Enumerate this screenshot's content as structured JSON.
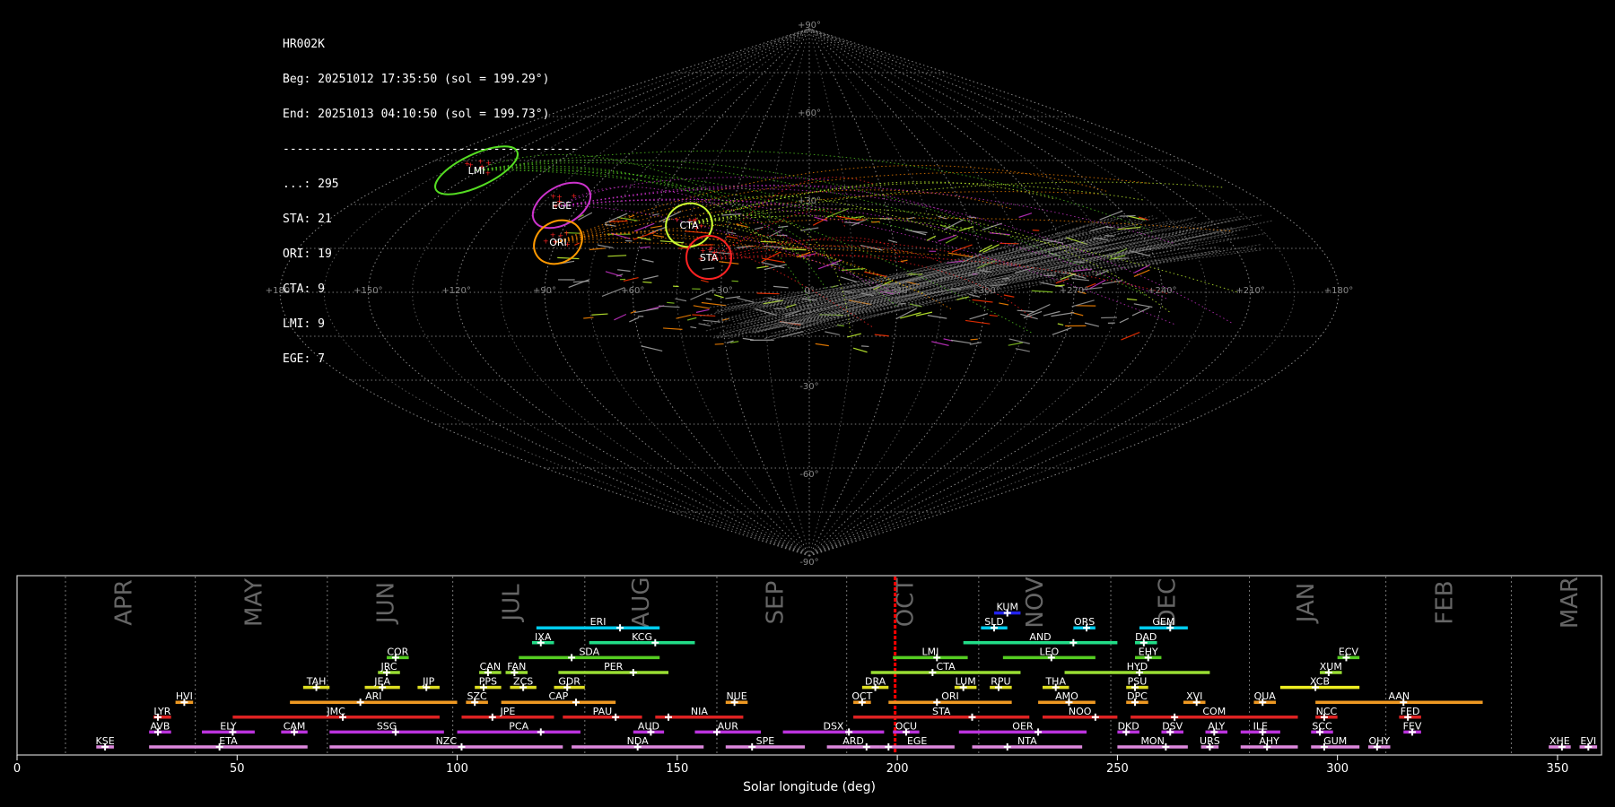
{
  "info": {
    "station": "HR002K",
    "beg": "Beg: 20251012 17:35:50 (sol = 199.29°)",
    "end": "End: 20251013 04:10:50 (sol = 199.73°)",
    "separator": "------------------------------------------",
    "counts": [
      "...: 295",
      "STA: 21",
      "ORI: 19",
      "CTA: 9",
      "LMI: 9",
      "EGE: 7"
    ]
  },
  "sky_map": {
    "projection": "sinusoidal",
    "lon_labels": [
      "+180°",
      "+150°",
      "+120°",
      "+90°",
      "+60°",
      "+30°",
      "0°",
      "+330°",
      "+300°",
      "+270°",
      "+240°",
      "+210°",
      "+180°"
    ],
    "lat_labels": [
      "+90°",
      "+60°",
      "+30°",
      "0°",
      "-30°",
      "-60°",
      "-90°"
    ],
    "radiants": [
      {
        "code": "LMI",
        "color": "#7CFC00",
        "ring": "#55dd22"
      },
      {
        "code": "EGE",
        "color": "#cc33cc",
        "ring": "#cc33cc"
      },
      {
        "code": "ORI",
        "color": "#ff9900",
        "ring": "#ff9900"
      },
      {
        "code": "CTA",
        "color": "#ccff33",
        "ring": "#ccff33"
      },
      {
        "code": "STA",
        "color": "#ff2222",
        "ring": "#ff2222"
      }
    ]
  },
  "chart_data": {
    "type": "bar",
    "title": "",
    "xlabel": "Solar longitude (deg)",
    "ylabel": "",
    "xlim": [
      0,
      360
    ],
    "xticks": [
      0,
      50,
      100,
      150,
      200,
      250,
      300,
      350
    ],
    "current_sol": 199.5,
    "months": [
      {
        "name": "APR",
        "start": 11,
        "label_x": 24.5
      },
      {
        "name": "MAY",
        "start": 40.5,
        "label_x": 54
      },
      {
        "name": "JUN",
        "start": 70.5,
        "label_x": 84
      },
      {
        "name": "JUL",
        "start": 99,
        "label_x": 112.5
      },
      {
        "name": "AUG",
        "start": 129,
        "label_x": 142
      },
      {
        "name": "SEP",
        "start": 159,
        "label_x": 172.5
      },
      {
        "name": "OCT",
        "start": 188.5,
        "label_x": 202
      },
      {
        "name": "NOV",
        "start": 218.5,
        "label_x": 231.5
      },
      {
        "name": "DEC",
        "start": 248.5,
        "label_x": 261.5
      },
      {
        "name": "JAN",
        "start": 280,
        "label_x": 293
      },
      {
        "name": "FEB",
        "start": 311,
        "label_x": 324.5
      },
      {
        "name": "MAR",
        "start": 339.5,
        "label_x": 353
      }
    ],
    "showers": [
      {
        "code": "KUM",
        "start": 222,
        "end": 228,
        "peak": 225,
        "row": 10,
        "color": "#2222ee"
      },
      {
        "code": "ERI",
        "start": 118,
        "end": 146,
        "peak": 137,
        "row": 9,
        "color": "#00ccee"
      },
      {
        "code": "SLD",
        "start": 219,
        "end": 225,
        "peak": 222,
        "row": 9,
        "color": "#00ccee"
      },
      {
        "code": "ORS",
        "start": 240,
        "end": 245,
        "peak": 243,
        "row": 9,
        "color": "#00ccee"
      },
      {
        "code": "GEM",
        "start": 255,
        "end": 266,
        "peak": 262,
        "row": 9,
        "color": "#00ccee"
      },
      {
        "code": "IXA",
        "start": 117,
        "end": 122,
        "peak": 119,
        "row": 8,
        "color": "#22dd88"
      },
      {
        "code": "KCG",
        "start": 130,
        "end": 154,
        "peak": 145,
        "row": 8,
        "color": "#22dd88"
      },
      {
        "code": "AND",
        "start": 215,
        "end": 250,
        "peak": 240,
        "row": 8,
        "color": "#22dd88"
      },
      {
        "code": "DAD",
        "start": 254,
        "end": 259,
        "peak": 256,
        "row": 8,
        "color": "#22dd88"
      },
      {
        "code": "COR",
        "start": 84,
        "end": 89,
        "peak": 86,
        "row": 7,
        "color": "#55cc22"
      },
      {
        "code": "SDA",
        "start": 114,
        "end": 146,
        "peak": 126,
        "row": 7,
        "color": "#55cc22"
      },
      {
        "code": "LMI",
        "start": 199,
        "end": 216,
        "peak": 209,
        "row": 7,
        "color": "#55cc22"
      },
      {
        "code": "LEO",
        "start": 224,
        "end": 245,
        "peak": 235,
        "row": 7,
        "color": "#55cc22"
      },
      {
        "code": "EHY",
        "start": 254,
        "end": 260,
        "peak": 257,
        "row": 7,
        "color": "#55cc22"
      },
      {
        "code": "ECV",
        "start": 300,
        "end": 305,
        "peak": 302,
        "row": 7,
        "color": "#55cc22"
      },
      {
        "code": "JRC",
        "start": 82,
        "end": 87,
        "peak": 84,
        "row": 6,
        "color": "#99dd33"
      },
      {
        "code": "CAN",
        "start": 105,
        "end": 110,
        "peak": 107,
        "row": 6,
        "color": "#99dd33"
      },
      {
        "code": "FAN",
        "start": 111,
        "end": 116,
        "peak": 113,
        "row": 6,
        "color": "#99dd33"
      },
      {
        "code": "PER",
        "start": 123,
        "end": 148,
        "peak": 140,
        "row": 6,
        "color": "#99dd33"
      },
      {
        "code": "CTA",
        "start": 194,
        "end": 228,
        "peak": 208,
        "row": 6,
        "color": "#99dd33"
      },
      {
        "code": "HYD",
        "start": 238,
        "end": 271,
        "peak": 255,
        "row": 6,
        "color": "#99dd33"
      },
      {
        "code": "XUM",
        "start": 296,
        "end": 301,
        "peak": 298,
        "row": 6,
        "color": "#99dd33"
      },
      {
        "code": "TAH",
        "start": 65,
        "end": 71,
        "peak": 68,
        "row": 5,
        "color": "#dddd22"
      },
      {
        "code": "JEA",
        "start": 79,
        "end": 87,
        "peak": 83,
        "row": 5,
        "color": "#dddd22"
      },
      {
        "code": "JIP",
        "start": 91,
        "end": 96,
        "peak": 93,
        "row": 5,
        "color": "#dddd22"
      },
      {
        "code": "PPS",
        "start": 104,
        "end": 110,
        "peak": 106,
        "row": 5,
        "color": "#dddd22"
      },
      {
        "code": "ZCS",
        "start": 112,
        "end": 118,
        "peak": 115,
        "row": 5,
        "color": "#dddd22"
      },
      {
        "code": "GDR",
        "start": 122,
        "end": 129,
        "peak": 125,
        "row": 5,
        "color": "#dddd22"
      },
      {
        "code": "DRA",
        "start": 192,
        "end": 198,
        "peak": 195,
        "row": 5,
        "color": "#dddd22"
      },
      {
        "code": "LUM",
        "start": 213,
        "end": 218,
        "peak": 215,
        "row": 5,
        "color": "#dddd22"
      },
      {
        "code": "RPU",
        "start": 221,
        "end": 226,
        "peak": 223,
        "row": 5,
        "color": "#dddd22"
      },
      {
        "code": "THA",
        "start": 233,
        "end": 239,
        "peak": 236,
        "row": 5,
        "color": "#dddd22"
      },
      {
        "code": "PSU",
        "start": 252,
        "end": 257,
        "peak": 254,
        "row": 5,
        "color": "#dddd22"
      },
      {
        "code": "XCB",
        "start": 287,
        "end": 305,
        "peak": 295,
        "row": 5,
        "color": "#eeee22"
      },
      {
        "code": "HVI",
        "start": 36,
        "end": 40,
        "peak": 38,
        "row": 4,
        "color": "#ee9922"
      },
      {
        "code": "ARI",
        "start": 62,
        "end": 100,
        "peak": 78,
        "row": 4,
        "color": "#ee9922"
      },
      {
        "code": "SZC",
        "start": 102,
        "end": 107,
        "peak": 104,
        "row": 4,
        "color": "#ee9922"
      },
      {
        "code": "CAP",
        "start": 110,
        "end": 136,
        "peak": 127,
        "row": 4,
        "color": "#ee9922"
      },
      {
        "code": "NUE",
        "start": 161,
        "end": 166,
        "peak": 163,
        "row": 4,
        "color": "#ee9922"
      },
      {
        "code": "OCT",
        "start": 190,
        "end": 194,
        "peak": 192,
        "row": 4,
        "color": "#ee9922"
      },
      {
        "code": "ORI",
        "start": 198,
        "end": 226,
        "peak": 209,
        "row": 4,
        "color": "#ee9922"
      },
      {
        "code": "AMO",
        "start": 232,
        "end": 245,
        "peak": 239,
        "row": 4,
        "color": "#ee9922"
      },
      {
        "code": "DPC",
        "start": 252,
        "end": 257,
        "peak": 254,
        "row": 4,
        "color": "#ee9922"
      },
      {
        "code": "XVI",
        "start": 265,
        "end": 270,
        "peak": 268,
        "row": 4,
        "color": "#ee9922"
      },
      {
        "code": "QUA",
        "start": 281,
        "end": 286,
        "peak": 283,
        "row": 4,
        "color": "#ee9922"
      },
      {
        "code": "AAN",
        "start": 295,
        "end": 333,
        "peak": 315,
        "row": 4,
        "color": "#ee9922"
      },
      {
        "code": "LYR",
        "start": 31,
        "end": 35,
        "peak": 32,
        "row": 3,
        "color": "#dd2222"
      },
      {
        "code": "JMC",
        "start": 49,
        "end": 96,
        "peak": 74,
        "row": 3,
        "color": "#dd2222"
      },
      {
        "code": "JPE",
        "start": 101,
        "end": 122,
        "peak": 108,
        "row": 3,
        "color": "#dd2222"
      },
      {
        "code": "PAU",
        "start": 124,
        "end": 142,
        "peak": 136,
        "row": 3,
        "color": "#dd2222"
      },
      {
        "code": "NIA",
        "start": 145,
        "end": 165,
        "peak": 148,
        "row": 3,
        "color": "#dd2222"
      },
      {
        "code": "STA",
        "start": 190,
        "end": 230,
        "peak": 217,
        "row": 3,
        "color": "#dd2222"
      },
      {
        "code": "NOO",
        "start": 233,
        "end": 250,
        "peak": 245,
        "row": 3,
        "color": "#dd2222"
      },
      {
        "code": "COM",
        "start": 253,
        "end": 291,
        "peak": 263,
        "row": 3,
        "color": "#dd2222"
      },
      {
        "code": "NCC",
        "start": 295,
        "end": 300,
        "peak": 297,
        "row": 3,
        "color": "#dd2222"
      },
      {
        "code": "FED",
        "start": 314,
        "end": 319,
        "peak": 316,
        "row": 3,
        "color": "#dd2222"
      },
      {
        "code": "AVB",
        "start": 30,
        "end": 35,
        "peak": 32,
        "row": 2,
        "color": "#bb33dd"
      },
      {
        "code": "ELY",
        "start": 42,
        "end": 54,
        "peak": 49,
        "row": 2,
        "color": "#bb33dd"
      },
      {
        "code": "CAM",
        "start": 60,
        "end": 66,
        "peak": 63,
        "row": 2,
        "color": "#bb33dd"
      },
      {
        "code": "SSG",
        "start": 71,
        "end": 97,
        "peak": 86,
        "row": 2,
        "color": "#bb33dd"
      },
      {
        "code": "PCA",
        "start": 100,
        "end": 128,
        "peak": 119,
        "row": 2,
        "color": "#bb33dd"
      },
      {
        "code": "AUD",
        "start": 140,
        "end": 147,
        "peak": 144,
        "row": 2,
        "color": "#bb33dd"
      },
      {
        "code": "AUR",
        "start": 154,
        "end": 169,
        "peak": 159,
        "row": 2,
        "color": "#bb33dd"
      },
      {
        "code": "DSX",
        "start": 174,
        "end": 197,
        "peak": 189,
        "row": 2,
        "color": "#bb33dd"
      },
      {
        "code": "OCU",
        "start": 199,
        "end": 205,
        "peak": 202,
        "row": 2,
        "color": "#bb33dd"
      },
      {
        "code": "OER",
        "start": 214,
        "end": 243,
        "peak": 232,
        "row": 2,
        "color": "#bb33dd"
      },
      {
        "code": "DKD",
        "start": 250,
        "end": 255,
        "peak": 252,
        "row": 2,
        "color": "#bb33dd"
      },
      {
        "code": "DSV",
        "start": 260,
        "end": 265,
        "peak": 262,
        "row": 2,
        "color": "#bb33dd"
      },
      {
        "code": "ALY",
        "start": 270,
        "end": 275,
        "peak": 272,
        "row": 2,
        "color": "#bb33dd"
      },
      {
        "code": "ILE",
        "start": 278,
        "end": 287,
        "peak": 283,
        "row": 2,
        "color": "#bb33dd"
      },
      {
        "code": "SCC",
        "start": 294,
        "end": 299,
        "peak": 296,
        "row": 2,
        "color": "#bb33dd"
      },
      {
        "code": "FEV",
        "start": 315,
        "end": 319,
        "peak": 317,
        "row": 2,
        "color": "#bb33dd"
      },
      {
        "code": "KSE",
        "start": 18,
        "end": 22,
        "peak": 20,
        "row": 1,
        "color": "#dd88dd"
      },
      {
        "code": "ETA",
        "start": 30,
        "end": 66,
        "peak": 46,
        "row": 1,
        "color": "#dd88dd"
      },
      {
        "code": "NZC",
        "start": 71,
        "end": 124,
        "peak": 101,
        "row": 1,
        "color": "#dd88dd"
      },
      {
        "code": "NDA",
        "start": 126,
        "end": 156,
        "peak": 141,
        "row": 1,
        "color": "#dd88dd"
      },
      {
        "code": "SPE",
        "start": 161,
        "end": 179,
        "peak": 167,
        "row": 1,
        "color": "#dd88dd"
      },
      {
        "code": "ARD",
        "start": 184,
        "end": 196,
        "peak": 193,
        "row": 1,
        "color": "#dd88dd"
      },
      {
        "code": "EGE",
        "start": 196,
        "end": 213,
        "peak": 198,
        "row": 1,
        "color": "#dd88dd"
      },
      {
        "code": "NTA",
        "start": 217,
        "end": 242,
        "peak": 225,
        "row": 1,
        "color": "#dd88dd"
      },
      {
        "code": "MON",
        "start": 250,
        "end": 266,
        "peak": 261,
        "row": 1,
        "color": "#dd88dd"
      },
      {
        "code": "URS",
        "start": 269,
        "end": 273,
        "peak": 271,
        "row": 1,
        "color": "#dd88dd"
      },
      {
        "code": "AHY",
        "start": 278,
        "end": 291,
        "peak": 284,
        "row": 1,
        "color": "#dd88dd"
      },
      {
        "code": "GUM",
        "start": 294,
        "end": 305,
        "peak": 297,
        "row": 1,
        "color": "#dd88dd"
      },
      {
        "code": "OHY",
        "start": 307,
        "end": 312,
        "peak": 309,
        "row": 1,
        "color": "#dd88dd"
      },
      {
        "code": "XHE",
        "start": 348,
        "end": 353,
        "peak": 351,
        "row": 1,
        "color": "#dd88dd"
      },
      {
        "code": "EVI",
        "start": 355,
        "end": 359,
        "peak": 357,
        "row": 1,
        "color": "#dd88dd"
      }
    ]
  }
}
